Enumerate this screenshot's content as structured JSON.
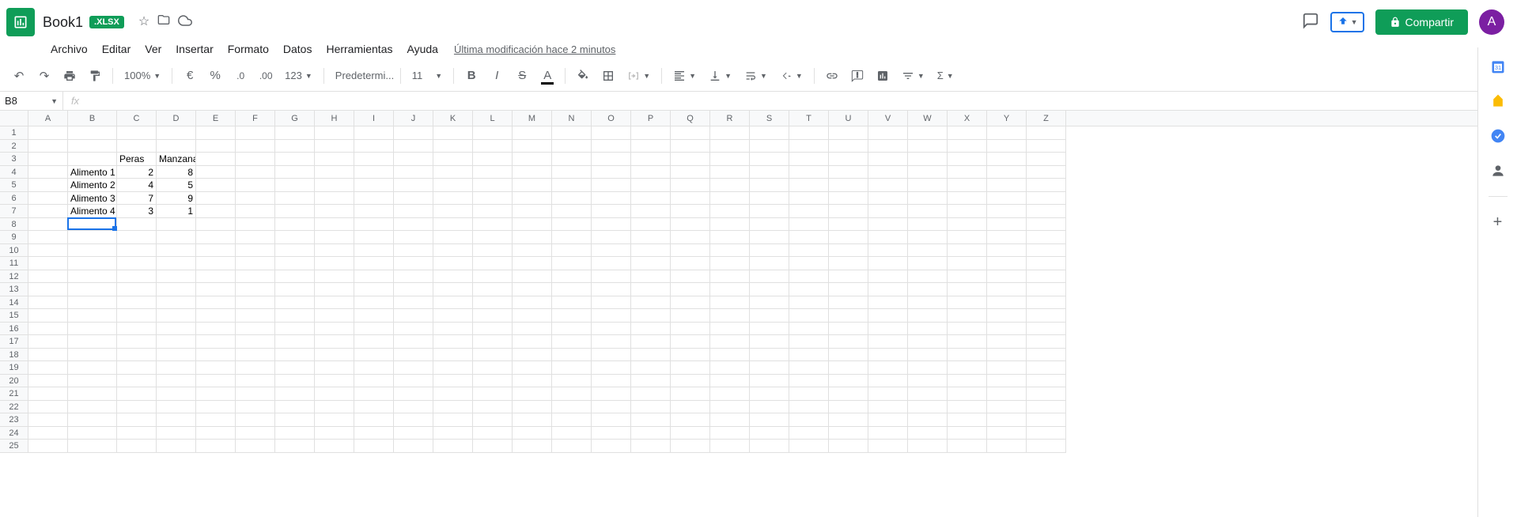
{
  "header": {
    "title": "Book1",
    "badge": ".XLSX",
    "share_label": "Compartir",
    "avatar_letter": "A"
  },
  "menu": {
    "items": [
      "Archivo",
      "Editar",
      "Ver",
      "Insertar",
      "Formato",
      "Datos",
      "Herramientas",
      "Ayuda"
    ],
    "last_modified": "Última modificación hace 2 minutos"
  },
  "toolbar": {
    "zoom": "100%",
    "number_format": "123",
    "font": "Predetermi...",
    "font_size": "11"
  },
  "formula_bar": {
    "name_box": "B8",
    "fx": "fx",
    "formula": ""
  },
  "grid": {
    "columns": [
      "A",
      "B",
      "C",
      "D",
      "E",
      "F",
      "G",
      "H",
      "I",
      "J",
      "K",
      "L",
      "M",
      "N",
      "O",
      "P",
      "Q",
      "R",
      "S",
      "T",
      "U",
      "V",
      "W",
      "X",
      "Y",
      "Z"
    ],
    "row_count": 25,
    "active_cell": "B8",
    "data": {
      "C3": "Peras",
      "D3": "Manzanas",
      "B4": "Alimento 1",
      "C4": "2",
      "D4": "8",
      "B5": "Alimento 2",
      "C5": "4",
      "D5": "5",
      "B6": "Alimento 3",
      "C6": "7",
      "D6": "9",
      "B7": "Alimento 4",
      "C7": "3",
      "D7": "1"
    }
  }
}
